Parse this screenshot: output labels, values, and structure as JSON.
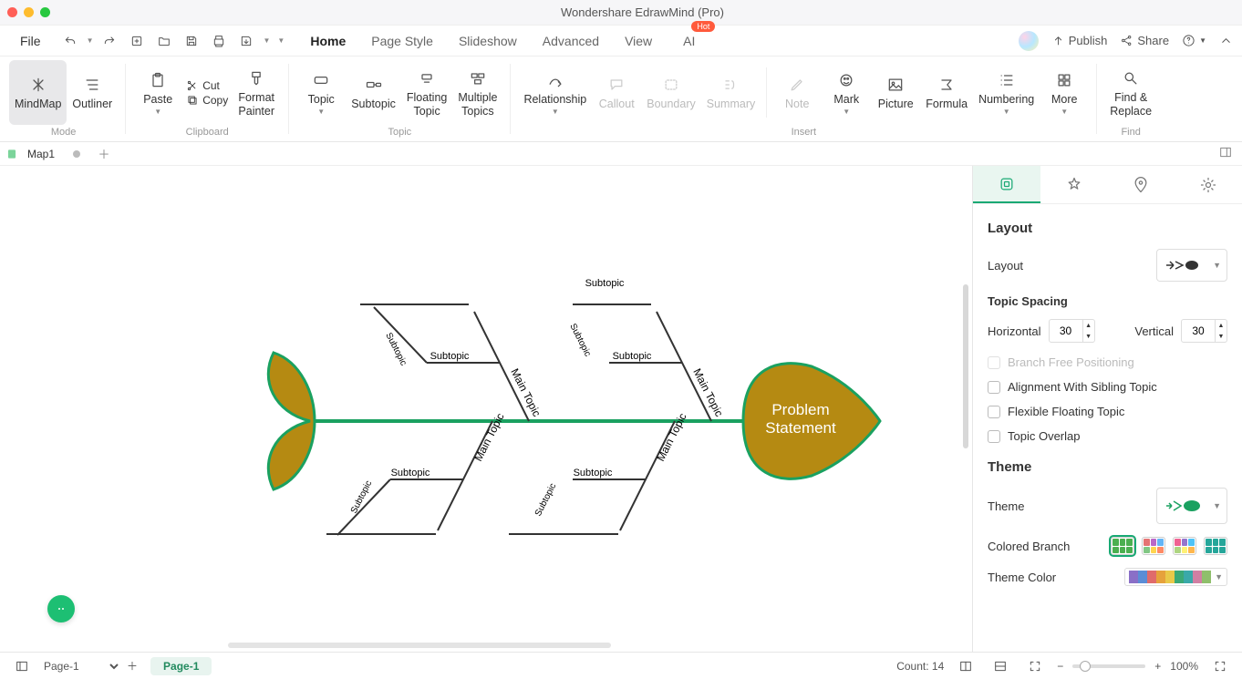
{
  "app": {
    "title": "Wondershare EdrawMind (Pro)"
  },
  "menu": {
    "file": "File",
    "tabs": [
      "Home",
      "Page Style",
      "Slideshow",
      "Advanced",
      "View",
      "AI"
    ],
    "active_tab": "Home",
    "ai_badge": "Hot",
    "publish": "Publish",
    "share": "Share"
  },
  "ribbon": {
    "mode": {
      "label": "Mode",
      "mindmap": "MindMap",
      "outliner": "Outliner"
    },
    "clipboard": {
      "label": "Clipboard",
      "paste": "Paste",
      "cut": "Cut",
      "copy": "Copy",
      "format_painter": "Format\nPainter"
    },
    "topic_group": {
      "label": "Topic",
      "topic": "Topic",
      "subtopic": "Subtopic",
      "floating": "Floating\nTopic",
      "multiple": "Multiple\nTopics"
    },
    "insert": {
      "label": "Insert",
      "relationship": "Relationship",
      "callout": "Callout",
      "boundary": "Boundary",
      "summary": "Summary",
      "note": "Note",
      "mark": "Mark",
      "picture": "Picture",
      "formula": "Formula",
      "numbering": "Numbering",
      "more": "More"
    },
    "find": {
      "label": "Find",
      "find_replace": "Find &\nReplace"
    }
  },
  "doc_tabs": {
    "tab1": "Map1"
  },
  "diagram": {
    "head": "Problem\nStatement",
    "main_topic": "Main Topic",
    "subtopic": "Subtopic"
  },
  "side": {
    "layout_title": "Layout",
    "layout_label": "Layout",
    "topic_spacing": "Topic Spacing",
    "horizontal": "Horizontal",
    "vertical": "Vertical",
    "h_value": "30",
    "v_value": "30",
    "branch_free": "Branch Free Positioning",
    "align_sibling": "Alignment With Sibling Topic",
    "flexible_floating": "Flexible Floating Topic",
    "topic_overlap": "Topic Overlap",
    "theme_title": "Theme",
    "theme_label": "Theme",
    "colored_branch": "Colored Branch",
    "theme_color": "Theme Color"
  },
  "status": {
    "page_select": "Page-1",
    "page_chip": "Page-1",
    "count": "Count: 14",
    "zoom": "100%"
  },
  "colors": {
    "fish_fill": "#b58a12",
    "fish_stroke": "#1aa160",
    "spine": "#1aa160"
  }
}
